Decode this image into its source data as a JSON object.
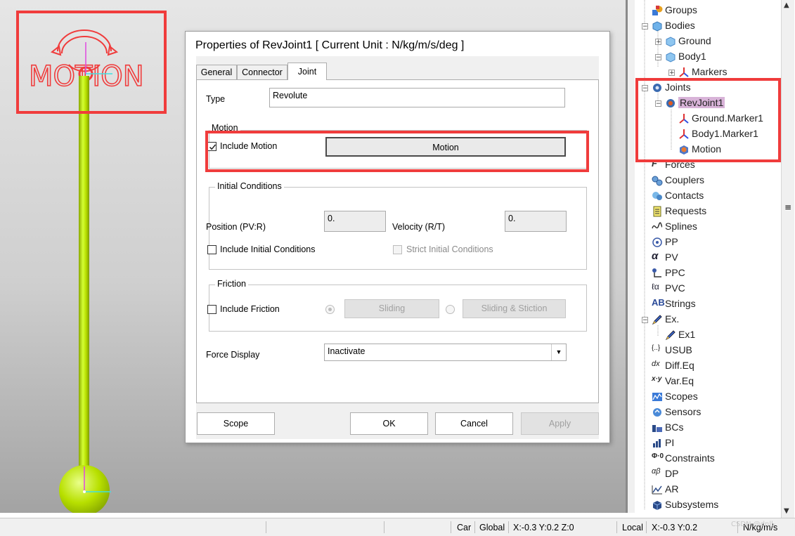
{
  "dialog": {
    "title": "Properties of RevJoint1 [ Current Unit : N/kg/m/s/deg ]",
    "tabs": [
      {
        "label": "General"
      },
      {
        "label": "Connector"
      },
      {
        "label": "Joint",
        "active": true
      }
    ],
    "type_label": "Type",
    "type_value": "Revolute",
    "motion_group": "Motion",
    "include_motion_label": "Include Motion",
    "include_motion_checked": true,
    "motion_button": "Motion",
    "initial_conditions_group": "Initial Conditions",
    "position_label": "Position (PV:R)",
    "position_value": "0.",
    "velocity_label": "Velocity (R/T)",
    "velocity_value": "0.",
    "include_initial_conditions_label": "Include Initial Conditions",
    "strict_initial_conditions_label": "Strict Initial Conditions",
    "friction_group": "Friction",
    "include_friction_label": "Include Friction",
    "sliding_button": "Sliding",
    "sliding_stiction_button": "Sliding & Stiction",
    "force_display_label": "Force Display",
    "force_display_value": "Inactivate",
    "buttons": {
      "scope": "Scope",
      "ok": "OK",
      "cancel": "Cancel",
      "apply": "Apply"
    }
  },
  "viewport": {
    "logo_text": "MOTION",
    "accent_color": "#f03c3c",
    "rod_color": "#c2e800"
  },
  "tree": {
    "items": [
      {
        "label": "Groups",
        "icon": "groups-icon"
      },
      {
        "label": "Bodies",
        "icon": "bodies-icon"
      },
      {
        "label": "Ground",
        "icon": "body-cube-icon"
      },
      {
        "label": "Body1",
        "icon": "body-cube-icon"
      },
      {
        "label": "Markers",
        "icon": "marker-icon"
      },
      {
        "label": "Joints",
        "icon": "joints-icon"
      },
      {
        "label": "RevJoint1",
        "icon": "revjoint-icon",
        "selected": true
      },
      {
        "label": "Ground.Marker1",
        "icon": "marker-icon"
      },
      {
        "label": "Body1.Marker1",
        "icon": "marker-icon"
      },
      {
        "label": "Motion",
        "icon": "motion-icon"
      },
      {
        "label": "Forces",
        "icon": "forces-icon"
      },
      {
        "label": "Couplers",
        "icon": "couplers-icon"
      },
      {
        "label": "Contacts",
        "icon": "contacts-icon"
      },
      {
        "label": "Requests",
        "icon": "requests-icon"
      },
      {
        "label": "Splines",
        "icon": "splines-icon"
      },
      {
        "label": "PP",
        "icon": "pp-icon"
      },
      {
        "label": "PV",
        "icon": "pv-icon"
      },
      {
        "label": "PPC",
        "icon": "ppc-icon"
      },
      {
        "label": "PVC",
        "icon": "pvc-icon"
      },
      {
        "label": "Strings",
        "icon": "strings-icon"
      },
      {
        "label": "Ex.",
        "icon": "expression-icon"
      },
      {
        "label": "Ex1",
        "icon": "expression-icon"
      },
      {
        "label": "USUB",
        "icon": "usub-icon"
      },
      {
        "label": "Diff.Eq",
        "icon": "diffeq-icon"
      },
      {
        "label": "Var.Eq",
        "icon": "vareq-icon"
      },
      {
        "label": "Scopes",
        "icon": "scopes-icon"
      },
      {
        "label": "Sensors",
        "icon": "sensors-icon"
      },
      {
        "label": "BCs",
        "icon": "bcs-icon"
      },
      {
        "label": "PI",
        "icon": "pi-icon"
      },
      {
        "label": "Constraints",
        "icon": "constraints-icon"
      },
      {
        "label": "DP",
        "icon": "dp-icon"
      },
      {
        "label": "AR",
        "icon": "ar-icon"
      },
      {
        "label": "Subsystems",
        "icon": "subsystems-icon"
      }
    ]
  },
  "status": {
    "mode": "Car",
    "global_label": "Global",
    "global_coords": "X:-0.3 Y:0.2 Z:0",
    "local_label": "Local",
    "local_coords": "X:-0.3 Y:0.2",
    "units": "N/kg/m/s",
    "watermark": "CSDN @dnll-"
  }
}
